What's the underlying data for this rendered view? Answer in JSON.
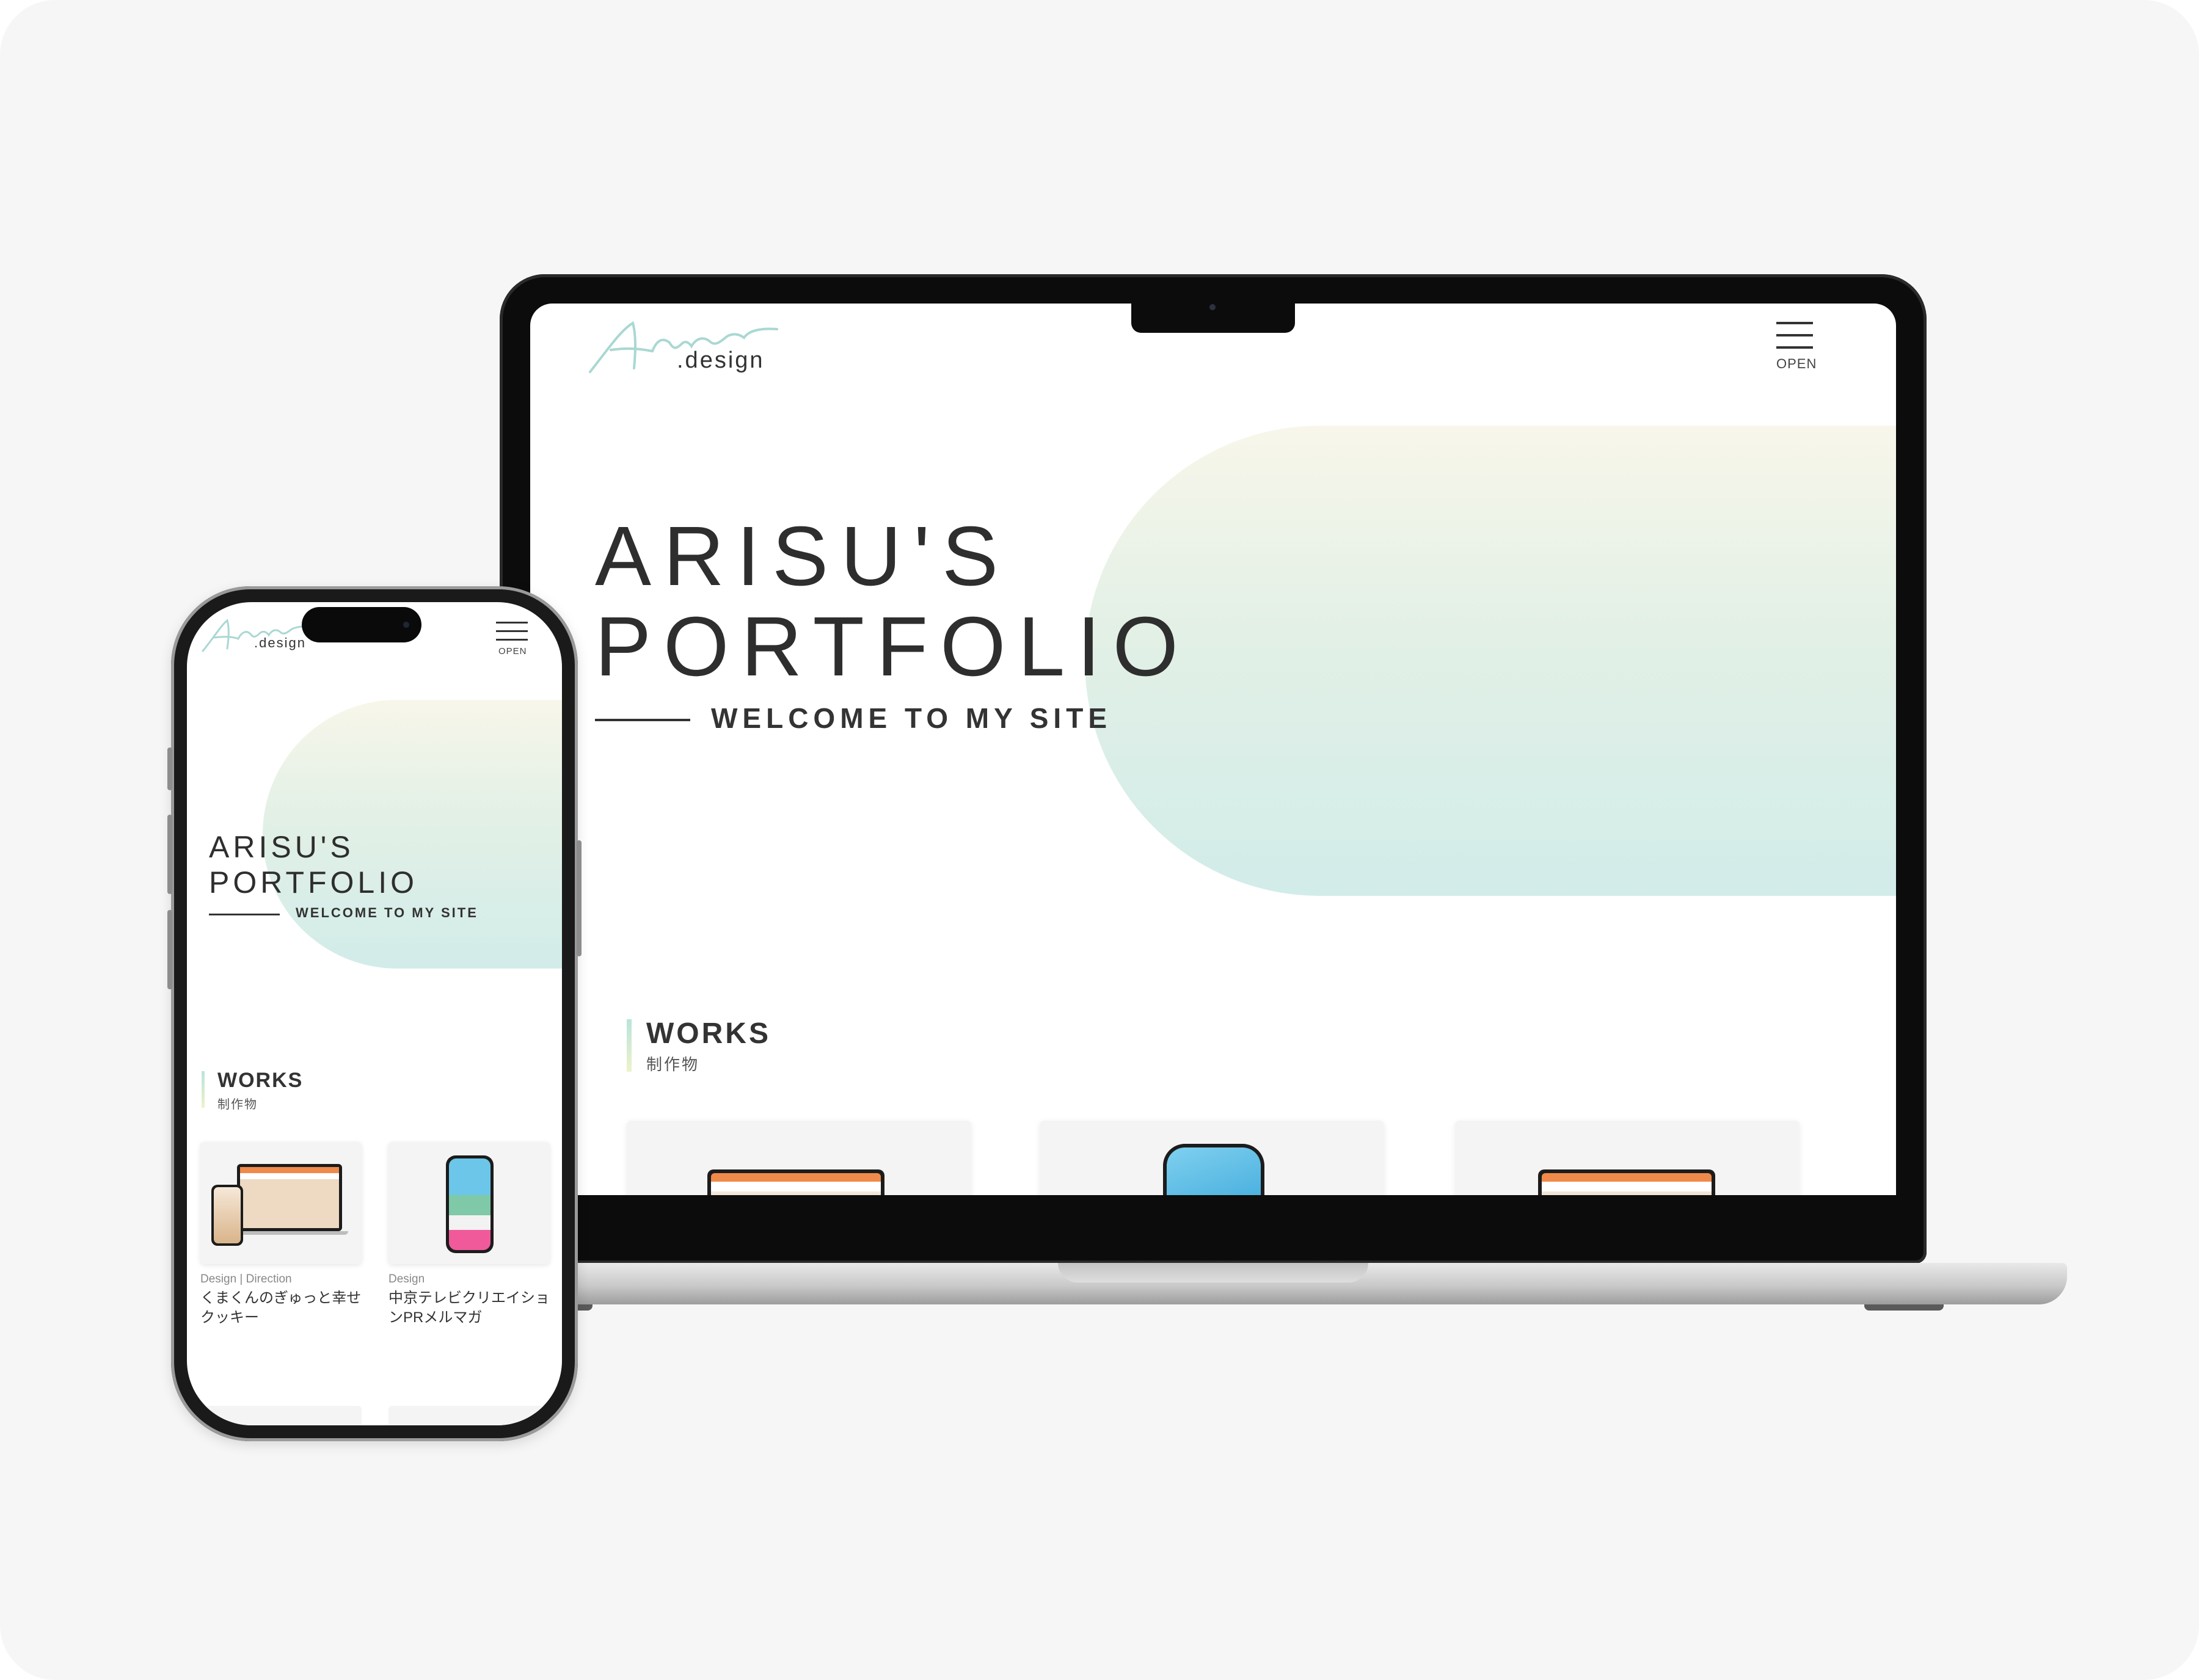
{
  "laptop_site": {
    "logo_text": ".design",
    "menu_label": "OPEN",
    "hero_title_line1": "ARISU'S",
    "hero_title_line2": "PORTFOLIO",
    "hero_subtitle": "WELCOME TO MY SITE",
    "works_title": "WORKS",
    "works_subtitle": "制作物"
  },
  "phone_site": {
    "logo_text": ".design",
    "menu_label": "OPEN",
    "hero_title_line1": "ARISU'S",
    "hero_title_line2": "PORTFOLIO",
    "hero_subtitle": "WELCOME TO MY SITE",
    "works_title": "WORKS",
    "works_subtitle": "制作物",
    "works": [
      {
        "category": "Design | Direction",
        "title": "くまくんのぎゅっと幸せクッキー"
      },
      {
        "category": "Design",
        "title": "中京テレビクリエイションPRメルマガ"
      }
    ]
  },
  "colors": {
    "page_bg": "#f6f6f6",
    "text": "#333333",
    "blob_top": "#f8f6ea",
    "blob_bottom": "#d2ece9",
    "logo_script": "#a9d8d2"
  },
  "icons": {
    "menu": "hamburger-icon",
    "logo": "arisu-script-logo"
  }
}
